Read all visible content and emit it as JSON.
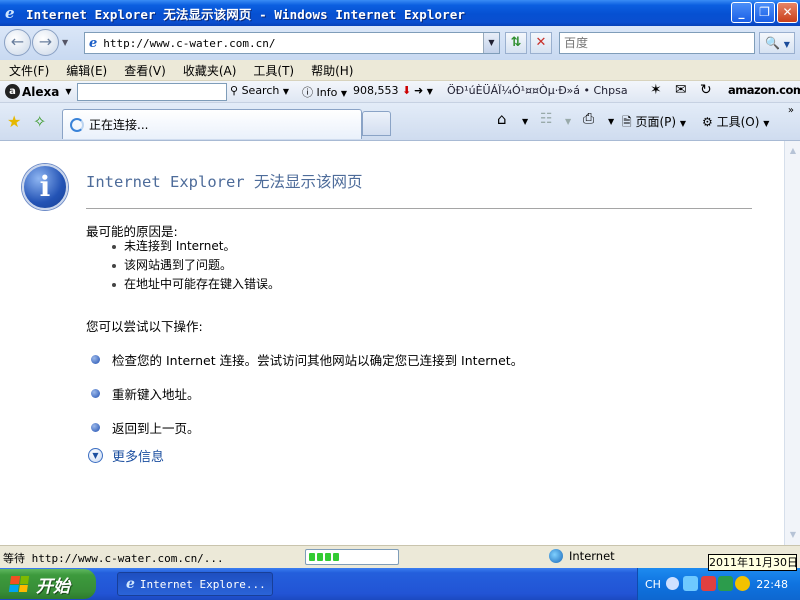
{
  "window": {
    "title": "Internet Explorer 无法显示该网页 - Windows Internet Explorer",
    "buttons": [
      "_",
      "❐",
      "✕"
    ]
  },
  "address_bar": {
    "url": "http://www.c-water.com.cn/",
    "search_placeholder": "百度"
  },
  "menu": {
    "items": [
      "文件(F)",
      "编辑(E)",
      "查看(V)",
      "收藏夹(A)",
      "工具(T)",
      "帮助(H)"
    ]
  },
  "alexa_toolbar": {
    "brand": "Alexa",
    "search_label": "Search",
    "info_label": "Info",
    "rank": "908,553",
    "garbled_text": "ÖÐ¹úÈÜÁÏ¼Ó¹¤¤Òµ·Ð»á",
    "site_abbr": "Chpsa",
    "amazon_label": "amazon.com."
  },
  "tabs": {
    "active_label": "正在连接..."
  },
  "command_bar": {
    "page_label": "页面(P)",
    "tools_label": "工具(O)"
  },
  "error_page": {
    "title": "Internet Explorer 无法显示该网页",
    "causes_heading": "最可能的原因是:",
    "causes": [
      "未连接到 Internet。",
      "该网站遇到了问题。",
      "在地址中可能存在键入错误。"
    ],
    "actions_heading": "您可以尝试以下操作:",
    "actions": [
      "检查您的 Internet 连接。尝试访问其他网站以确定您已连接到 Internet。",
      "重新键入地址。",
      "返回到上一页。"
    ],
    "more_info": "更多信息"
  },
  "status_bar": {
    "message": "等待 http://www.c-water.com.cn/...",
    "zone": "Internet",
    "progress_blocks": 4,
    "date_tooltip": "2011年11月30日"
  },
  "taskbar": {
    "start_label": "开始",
    "task_item": "Internet Explore...",
    "lang": "CH",
    "time": "22:48"
  },
  "colors": {
    "title_blue": "#0650d2",
    "error_title": "#4e6c9a",
    "link_blue": "#1c4fa0",
    "start_green": "#3d9a3d"
  }
}
